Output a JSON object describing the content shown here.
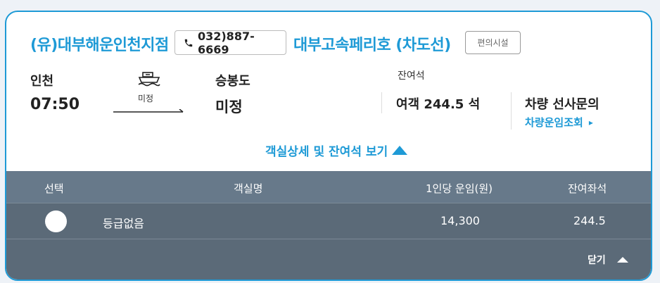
{
  "header": {
    "company": "(유)대부해운인천지점",
    "phone": "032)887-6669",
    "ship_name": "대부고속페리호 (차도선)",
    "facility_label": "편의시설"
  },
  "route": {
    "departure_port": "인천",
    "departure_time": "07:50",
    "via": "미정",
    "arrival_port": "승봉도",
    "arrival_name": "미정"
  },
  "seats": {
    "heading": "잔여석",
    "value": "여객 244.5 석"
  },
  "vehicle": {
    "title": "차량 선사문의",
    "link": "차량운임조회"
  },
  "detail_toggle": "객실상세 및 잔여석 보기",
  "table": {
    "headers": [
      "선택",
      "객실명",
      "1인당 운임(원)",
      "잔여좌석"
    ],
    "rows": [
      {
        "room": "등급없음",
        "fare": "14,300",
        "remaining": "244.5"
      }
    ],
    "close_label": "닫기"
  },
  "colors": {
    "accent": "#1e9ad6",
    "table_header": "#67798a",
    "table_body": "#5b6a78"
  }
}
